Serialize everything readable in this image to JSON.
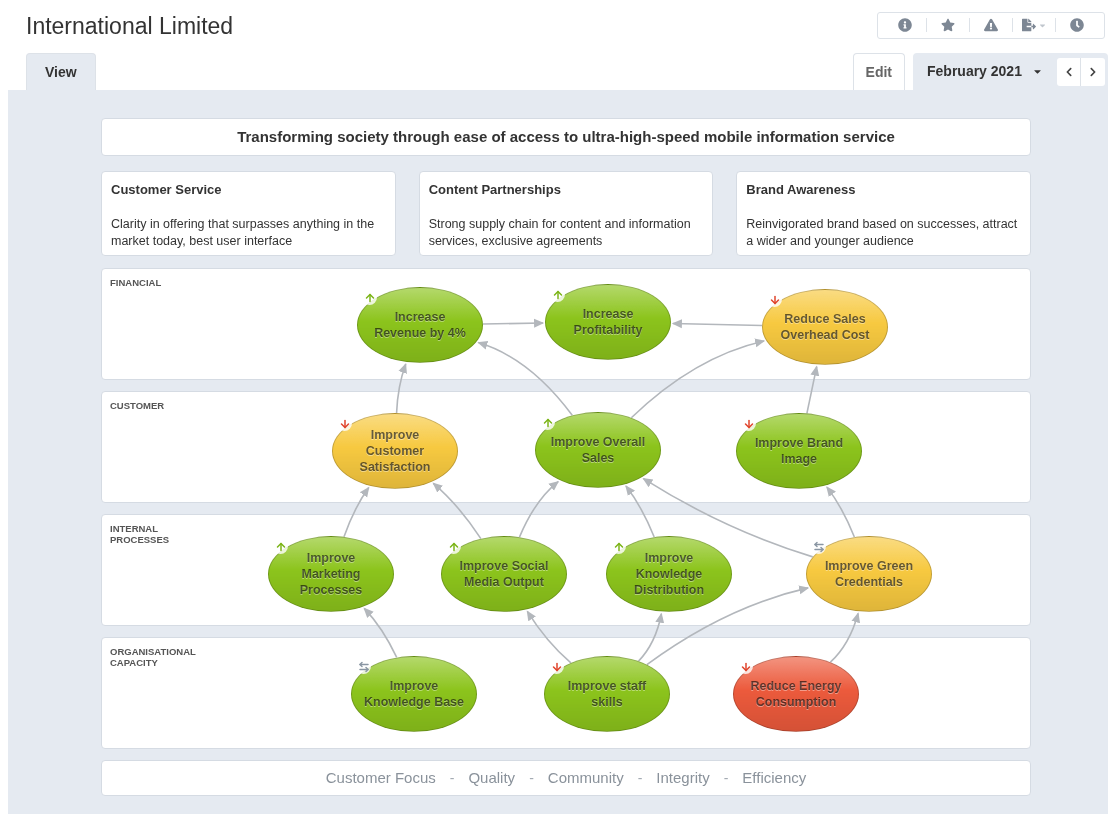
{
  "header": {
    "title": "International Limited"
  },
  "toolbar": [
    {
      "kind": "info"
    },
    {
      "kind": "favorite"
    },
    {
      "kind": "alert"
    },
    {
      "kind": "export"
    },
    {
      "kind": "history"
    }
  ],
  "tabs": [
    {
      "label": "View",
      "selected": true
    },
    {
      "label": "Edit",
      "selected": false
    }
  ],
  "period": {
    "label": "February 2021"
  },
  "mission": "Transforming society through ease of access to ultra-high-speed mobile information service",
  "themes": [
    {
      "title": "Customer Service",
      "description": "Clarity in offering that surpasses anything in the market today, best user interface"
    },
    {
      "title": "Content Partnerships",
      "description": "Strong supply chain for content and information services, exclusive agreements"
    },
    {
      "title": "Brand Awareness",
      "description": "Reinvigorated brand based on successes, attract a wider and younger audience"
    }
  ],
  "perspectives": [
    {
      "label": "FINANCIAL",
      "objectives": [
        {
          "label": "Increase Revenue by 4%",
          "color": "#8cc41c",
          "kind": "up"
        },
        {
          "label": "Increase Profitability",
          "color": "#8cc41c",
          "kind": "up"
        },
        {
          "label": "Reduce Sales Overhead Cost",
          "color": "#f7c940",
          "kind": "down"
        }
      ]
    },
    {
      "label": "CUSTOMER",
      "objectives": [
        {
          "label": "Improve Customer Satisfaction",
          "color": "#f7c940",
          "kind": "down"
        },
        {
          "label": "Improve Overall Sales",
          "color": "#8cc41c",
          "kind": "up"
        },
        {
          "label": "Improve Brand Image",
          "color": "#8cc41c",
          "kind": "down"
        }
      ]
    },
    {
      "label": "INTERNAL PROCESSES",
      "objectives": [
        {
          "label": "Improve Marketing Processes",
          "color": "#8cc41c",
          "kind": "up"
        },
        {
          "label": "Improve Social Media Output",
          "color": "#8cc41c",
          "kind": "up"
        },
        {
          "label": "Improve Knowledge Distribution",
          "color": "#8cc41c",
          "kind": "up"
        },
        {
          "label": "Improve Green Credentials",
          "color": "#f7c940",
          "kind": "flat"
        }
      ]
    },
    {
      "label": "ORGANISATIONAL CAPACITY",
      "objectives": [
        {
          "label": "Improve Knowledge Base",
          "color": "#8cc41c",
          "kind": "flat"
        },
        {
          "label": "Improve staff skills",
          "color": "#8cc41c",
          "kind": "down"
        },
        {
          "label": "Reduce Energy Consumption",
          "color": "#ec5a3c",
          "kind": "down"
        }
      ]
    }
  ],
  "values": [
    {
      "kind": "value",
      "text": "Customer Focus"
    },
    {
      "kind": "separator",
      "text": "-"
    },
    {
      "kind": "value",
      "text": "Quality"
    },
    {
      "kind": "separator",
      "text": "-"
    },
    {
      "kind": "value",
      "text": "Community"
    },
    {
      "kind": "separator",
      "text": "-"
    },
    {
      "kind": "value",
      "text": "Integrity"
    },
    {
      "kind": "separator",
      "text": "-"
    },
    {
      "kind": "value",
      "text": "Efficiency"
    }
  ]
}
